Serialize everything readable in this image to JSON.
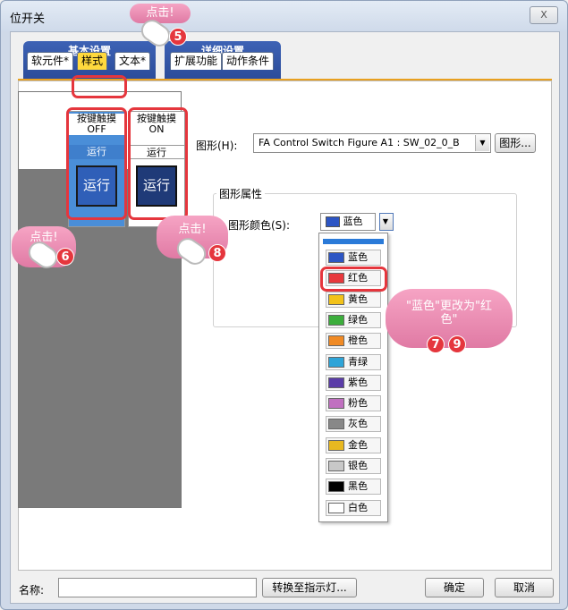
{
  "window": {
    "title": "位开关",
    "close_symbol": "X"
  },
  "tabs": {
    "basic_group": "基本设置",
    "detail_group": "详细设置",
    "items": [
      {
        "label": "软元件*",
        "active": false
      },
      {
        "label": "样式",
        "active": true
      },
      {
        "label": "文本*",
        "active": false
      },
      {
        "label": "扩展功能",
        "active": false
      },
      {
        "label": "动作条件",
        "active": false
      }
    ]
  },
  "preview": {
    "off": {
      "head": "按键触摸 OFF",
      "sub": "运行",
      "btn_text": "运行"
    },
    "on": {
      "head": "按键触摸 ON",
      "sub": "运行",
      "btn_text": "运行"
    }
  },
  "figure": {
    "label": "图形(H):",
    "value": "FA Control Switch Figure A1 : SW_02_0_B",
    "button": "图形..."
  },
  "figure_props": {
    "title": "图形属性",
    "color_label": "图形颜色(S):",
    "color_value": "蓝色",
    "color_value_hex": "#2c55c4"
  },
  "color_options": [
    {
      "label": "蓝色",
      "hex": "#2c55c4"
    },
    {
      "label": "红色",
      "hex": "#e8383c"
    },
    {
      "label": "黄色",
      "hex": "#f2c21a"
    },
    {
      "label": "绿色",
      "hex": "#3cae3c"
    },
    {
      "label": "橙色",
      "hex": "#f08a24"
    },
    {
      "label": "青绿",
      "hex": "#2ea4d8"
    },
    {
      "label": "紫色",
      "hex": "#5a3ca8"
    },
    {
      "label": "粉色",
      "hex": "#c070c0"
    },
    {
      "label": "灰色",
      "hex": "#888888"
    },
    {
      "label": "金色",
      "hex": "#e8b820"
    },
    {
      "label": "银色",
      "hex": "#c8c8c8"
    },
    {
      "label": "黑色",
      "hex": "#000000"
    },
    {
      "label": "白色",
      "hex": "#ffffff"
    }
  ],
  "footer": {
    "name_label": "名称:",
    "name_value": "",
    "convert_button": "转换至指示灯...",
    "ok_button": "确定",
    "cancel_button": "取消"
  },
  "callouts": {
    "click5": "点击!",
    "step5": "5",
    "click6": "点击!",
    "step6": "6",
    "click8": "点击!",
    "step8": "8",
    "note": "\"蓝色\"更改为\"红色\"",
    "step7": "7",
    "step9": "9"
  }
}
